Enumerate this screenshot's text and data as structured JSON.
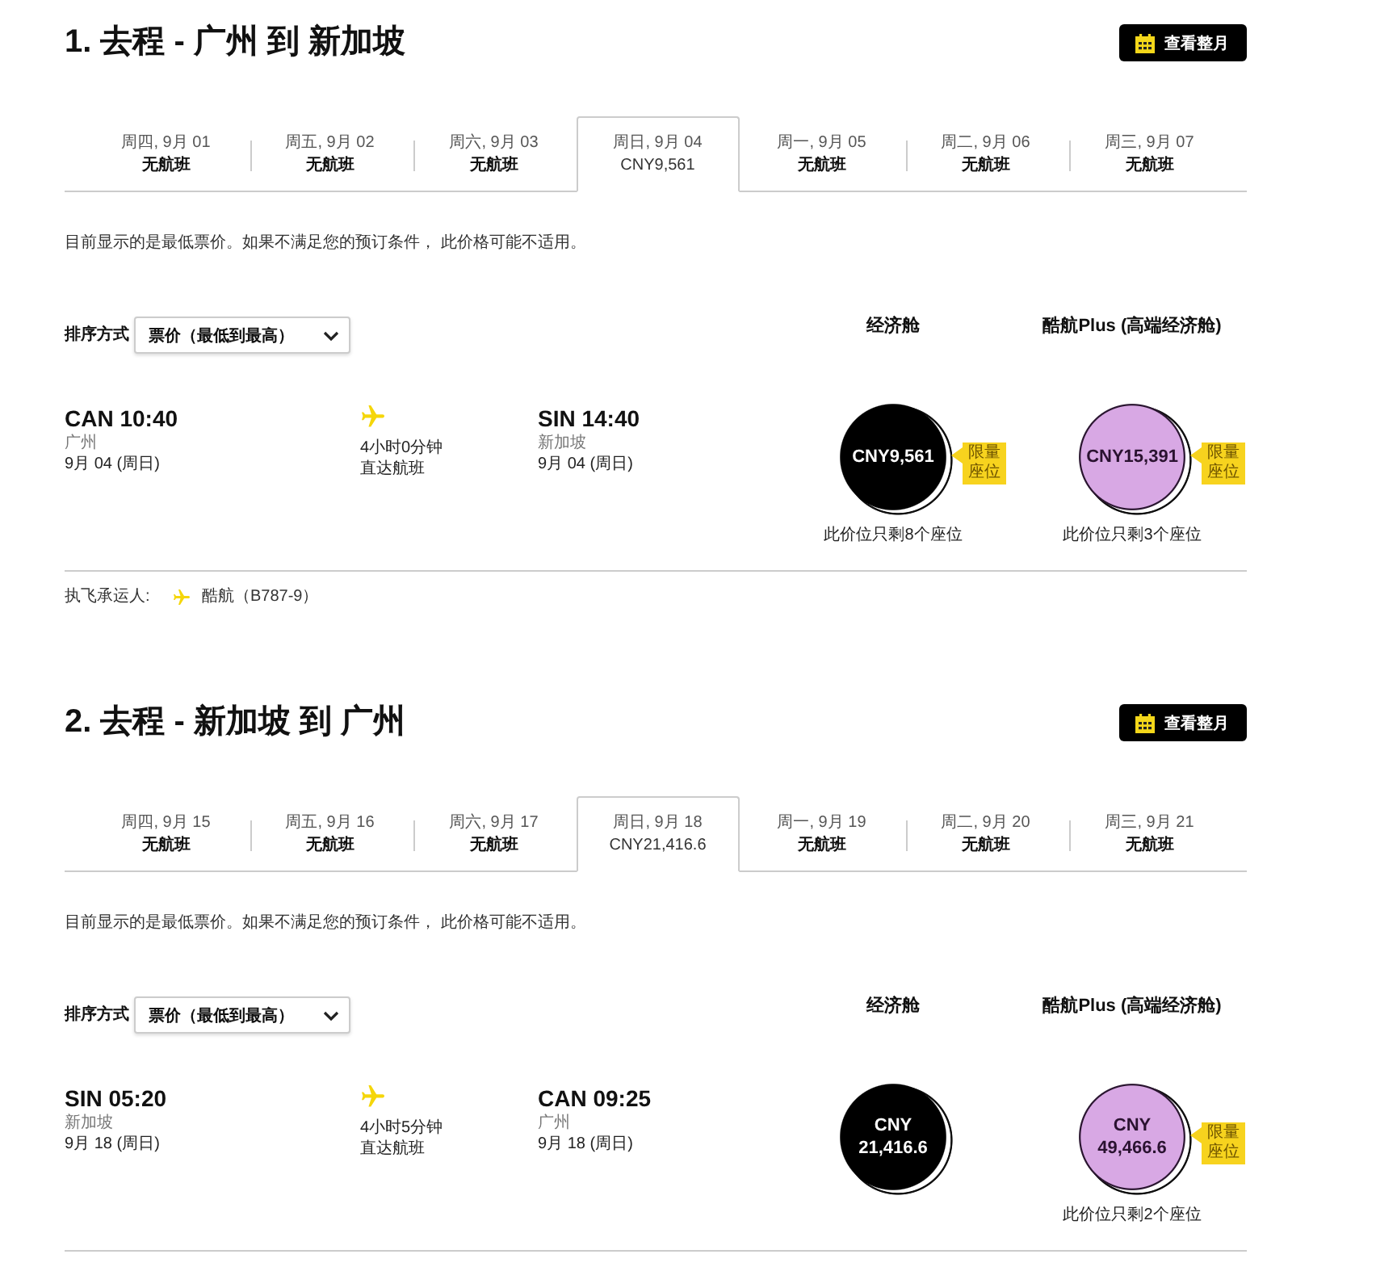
{
  "sections": [
    {
      "title": "1. 去程 - 广州 到 新加坡",
      "month_button": "查看整月",
      "date_tabs": [
        {
          "day": "周四, 9月 01",
          "price": "无航班",
          "selected": false
        },
        {
          "day": "周五, 9月 02",
          "price": "无航班",
          "selected": false
        },
        {
          "day": "周六, 9月 03",
          "price": "无航班",
          "selected": false
        },
        {
          "day": "周日, 9月 04",
          "price": "CNY9,561",
          "selected": true
        },
        {
          "day": "周一, 9月 05",
          "price": "无航班",
          "selected": false
        },
        {
          "day": "周二, 9月 06",
          "price": "无航班",
          "selected": false
        },
        {
          "day": "周三, 9月 07",
          "price": "无航班",
          "selected": false
        }
      ],
      "notice": "目前显示的是最低票价。如果不满足您的预订条件， 此价格可能不适用。",
      "sort": {
        "label": "排序方式",
        "value": "票价（最低到最高）"
      },
      "fare_headers": [
        "经济舱",
        "酷航Plus (高端经济舱)"
      ],
      "flight": {
        "departure": {
          "code_time": "CAN 10:40",
          "city": "广州",
          "date": "9月 04 (周日)"
        },
        "duration": "4小时0分钟",
        "stops": "直达航班",
        "arrival": {
          "code_time": "SIN 14:40",
          "city": "新加坡",
          "date": "9月 04 (周日)"
        }
      },
      "fares": [
        {
          "kind": "economy",
          "price_lines": [
            "CNY9,561"
          ],
          "badge": "限量座位",
          "seats_left": "此价位只剩8个座位"
        },
        {
          "kind": "plus",
          "price_lines": [
            "CNY15,391"
          ],
          "badge": "限量座位",
          "seats_left": "此价位只剩3个座位"
        }
      ],
      "carrier": {
        "label": "执飞承运人:",
        "name": "酷航（B787-9）"
      }
    },
    {
      "title": "2. 去程 - 新加坡 到 广州",
      "month_button": "查看整月",
      "date_tabs": [
        {
          "day": "周四, 9月 15",
          "price": "无航班",
          "selected": false
        },
        {
          "day": "周五, 9月 16",
          "price": "无航班",
          "selected": false
        },
        {
          "day": "周六, 9月 17",
          "price": "无航班",
          "selected": false
        },
        {
          "day": "周日, 9月 18",
          "price": "CNY21,416.6",
          "selected": true
        },
        {
          "day": "周一, 9月 19",
          "price": "无航班",
          "selected": false
        },
        {
          "day": "周二, 9月 20",
          "price": "无航班",
          "selected": false
        },
        {
          "day": "周三, 9月 21",
          "price": "无航班",
          "selected": false
        }
      ],
      "notice": "目前显示的是最低票价。如果不满足您的预订条件， 此价格可能不适用。",
      "sort": {
        "label": "排序方式",
        "value": "票价（最低到最高）"
      },
      "fare_headers": [
        "经济舱",
        "酷航Plus (高端经济舱)"
      ],
      "flight": {
        "departure": {
          "code_time": "SIN 05:20",
          "city": "新加坡",
          "date": "9月 18 (周日)"
        },
        "duration": "4小时5分钟",
        "stops": "直达航班",
        "arrival": {
          "code_time": "CAN 09:25",
          "city": "广州",
          "date": "9月 18 (周日)"
        }
      },
      "fares": [
        {
          "kind": "economy",
          "price_lines": [
            "CNY",
            "21,416.6"
          ]
        },
        {
          "kind": "plus",
          "price_lines": [
            "CNY",
            "49,466.6"
          ],
          "badge": "限量座位",
          "seats_left": "此价位只剩2个座位"
        }
      ]
    }
  ]
}
